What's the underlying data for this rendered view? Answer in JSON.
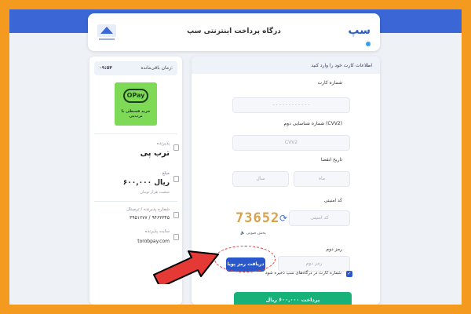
{
  "header": {
    "title": "درگاه پرداخت اینترنتی سپ",
    "logo_text": "سپ"
  },
  "sidebar": {
    "timer_label": "زمان باقی‌مانده:",
    "timer_value": "۰۹:۵۴",
    "opay_logo": "OPay",
    "opay_sub": "خرید قسطی با ترب‌پی",
    "merchant_label": "پذیرنده",
    "merchant_name": "ترب پی",
    "amount_label": "مبلغ",
    "amount_value": "۶۰۰,۰۰۰ ریال",
    "amount_words": "شصت هزار تومان",
    "terminal_label": "شماره پذیرنده / ترمینال",
    "terminal_value": "۳۹۵۱۲۷۷ / ۹۴۶۳۳۴۵",
    "site_label": "سایت پذیرنده",
    "site_value": "torobpay.com"
  },
  "form": {
    "heading": "اطلاعات کارت خود را وارد کنید",
    "card_label": "شماره کارت",
    "card_placeholder": "- - - -   - - - -   - - - -",
    "cvv2_label": "شماره شناسایی دوم (CVV2)",
    "cvv2_placeholder": "CVV2",
    "expiry_label": "تاریخ انقضا",
    "month_placeholder": "ماه",
    "year_placeholder": "سال",
    "captcha_label": "کد امنیتی",
    "captcha_placeholder": "کد امنیتی",
    "captcha_value": "73652",
    "voice_label": "پخش صوتی",
    "otp_label": "رمز دوم",
    "otp_placeholder": "رمز دوم",
    "otp_button": "دریافت رمز پویا",
    "save_card_label": "شماره کارت در درگاه‌های سپ ذخیره شود",
    "pay_button": "پرداخت ۶۰۰,۰۰۰ ریال"
  },
  "colors": {
    "frame_border": "#f39a1f",
    "topbar": "#3b66d6",
    "primary": "#2a57c9",
    "pay": "#17b27a",
    "opay": "#7ed957",
    "captcha": "#d8a14a",
    "highlight": "#e53935"
  }
}
